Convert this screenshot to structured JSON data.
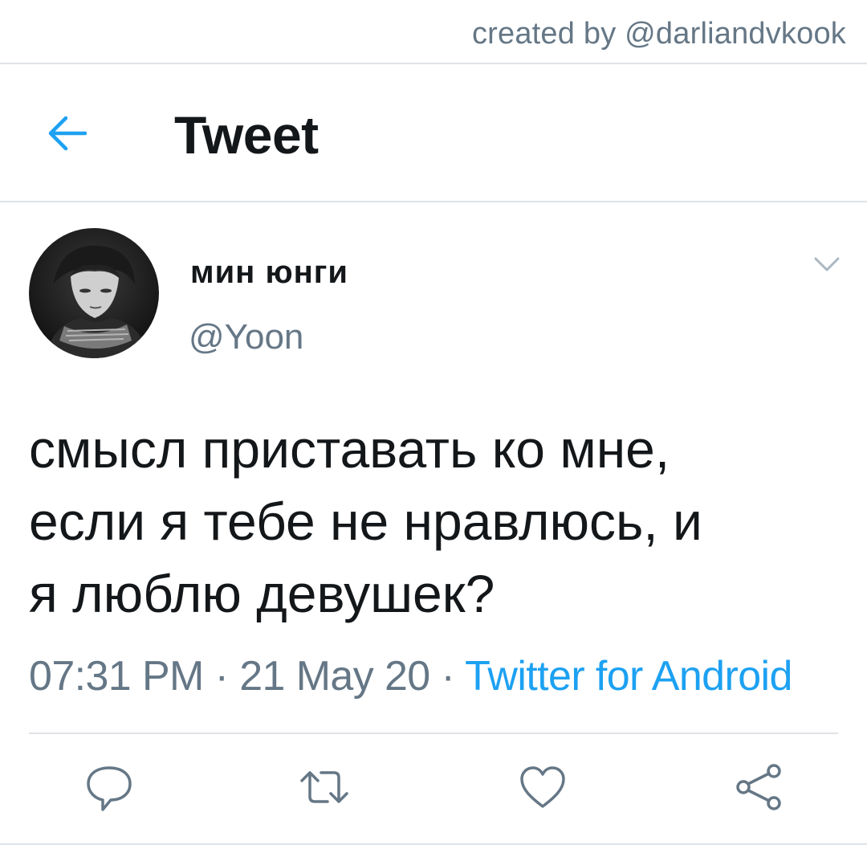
{
  "credit": {
    "text": "created by @darliandvkook"
  },
  "header": {
    "title": "Tweet",
    "back_icon": "arrow-left-icon"
  },
  "author": {
    "display_name": "мин юнги",
    "handle": "@Yoon",
    "avatar_icon": "profile-photo"
  },
  "tweet": {
    "text": "смысл приставать ко мне,\nесли я тебе не нравлюсь, и\nя люблю девушек?",
    "time": "07:31 PM",
    "separator": " · ",
    "date": "21 May 20",
    "source": "Twitter for Android"
  },
  "actions": {
    "reply_icon": "reply-icon",
    "retweet_icon": "retweet-icon",
    "like_icon": "heart-icon",
    "share_icon": "share-icon"
  },
  "colors": {
    "accent": "#1da1f2",
    "secondary_text": "#657786",
    "primary_text": "#14171a",
    "divider": "#dfe3e7"
  }
}
